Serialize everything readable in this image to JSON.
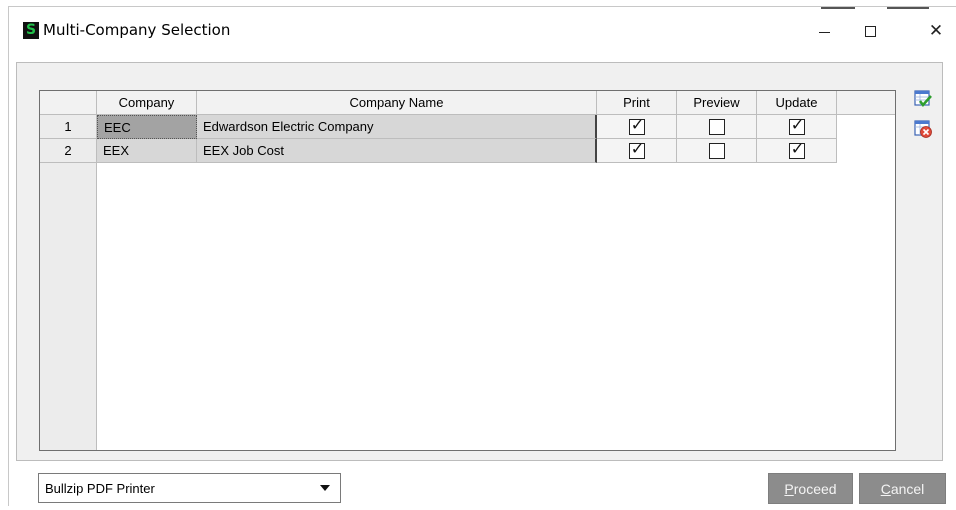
{
  "window": {
    "app_icon_letter": "S",
    "title": "Multi-Company Selection",
    "controls": {
      "minimize_icon": "minimize-icon",
      "maximize_icon": "maximize-icon",
      "close_icon": "close-icon"
    }
  },
  "grid": {
    "columns": [
      "Company",
      "Company Name",
      "Print",
      "Preview",
      "Update"
    ],
    "rows": [
      {
        "num": "1",
        "company": "EEC",
        "company_name": "Edwardson Electric Company",
        "print": true,
        "preview": false,
        "update": true
      },
      {
        "num": "2",
        "company": "EEX",
        "company_name": "EEX Job Cost",
        "print": true,
        "preview": false,
        "update": true
      }
    ],
    "check_glyph": "✓"
  },
  "side_tools": {
    "select_all_icon": "select-all-icon",
    "clear_all_icon": "clear-all-icon"
  },
  "printer": {
    "selected": "Bullzip PDF Printer"
  },
  "buttons": {
    "proceed": {
      "accel": "P",
      "rest": "roceed"
    },
    "cancel": {
      "accel": "C",
      "rest": "ancel"
    }
  },
  "colors": {
    "accent_green": "#21c04a",
    "button_gray": "#8c8c8c"
  }
}
